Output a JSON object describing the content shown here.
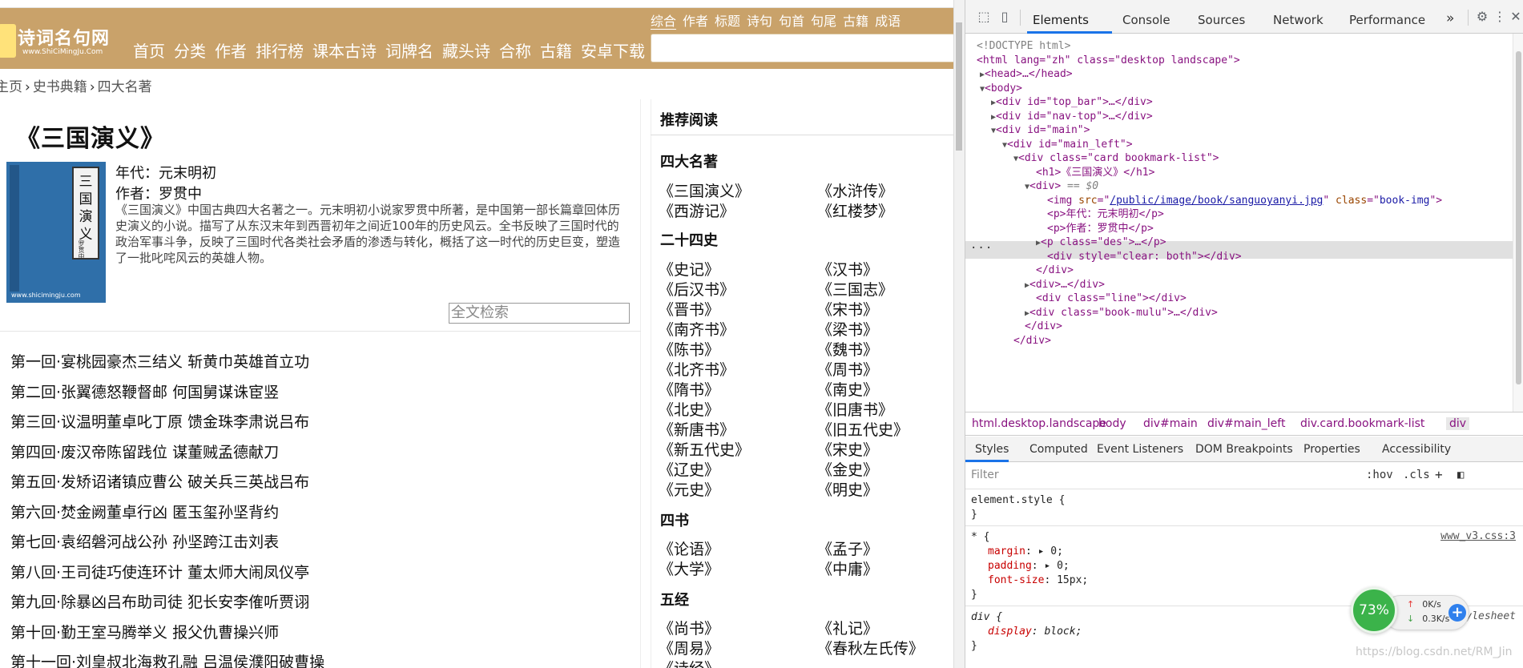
{
  "site": {
    "logo_title": "诗词名句网",
    "logo_sub": "www.ShiCiMingJu.Com",
    "nav": [
      "首页",
      "分类",
      "作者",
      "排行榜",
      "课本古诗",
      "词牌名",
      "藏头诗",
      "合称",
      "古籍",
      "安卓下载"
    ],
    "search_tabs": [
      "综合",
      "作者",
      "标题",
      "诗句",
      "句首",
      "句尾",
      "古籍",
      "成语"
    ],
    "breadcrumb": [
      "主页",
      "史书典籍",
      "四大名著"
    ]
  },
  "book": {
    "title": "《三国演义》",
    "cover_label": "三国演义",
    "cover_author": "罗贯中",
    "cover_url": "www.shicimingju.com",
    "era": "年代：元末明初",
    "author": "作者：罗贯中",
    "description": "《三国演义》中国古典四大名著之一。元末明初小说家罗贯中所著，是中国第一部长篇章回体历史演义的小说。描写了从东汉末年到西晋初年之间近100年的历史风云。全书反映了三国时代的政治军事斗争，反映了三国时代各类社会矛盾的渗透与转化，概括了这一时代的历史巨变，塑造了一批叱咤风云的英雄人物。",
    "fulltext_placeholder": "全文检索",
    "chapters": [
      "第一回·宴桃园豪杰三结义 斩黄巾英雄首立功",
      "第二回·张翼德怒鞭督邮 何国舅谋诛宦竖",
      "第三回·议温明董卓叱丁原 馈金珠李肃说吕布",
      "第四回·废汉帝陈留践位 谋董贼孟德献刀",
      "第五回·发矫诏诸镇应曹公 破关兵三英战吕布",
      "第六回·焚金阙董卓行凶 匿玉玺孙坚背约",
      "第七回·袁绍磐河战公孙 孙坚跨江击刘表",
      "第八回·王司徒巧使连环计 董太师大闹凤仪亭",
      "第九回·除暴凶吕布助司徒 犯长安李傕听贾诩",
      "第十回·勤王室马腾举义 报父仇曹操兴师",
      "第十一回·刘皇叔北海救孔融 吕温侯濮阳破曹操"
    ]
  },
  "sidebar": {
    "heading": "推荐阅读",
    "groups": [
      {
        "title": "四大名著",
        "books": [
          "《三国演义》",
          "《水浒传》",
          "《西游记》",
          "《红楼梦》"
        ]
      },
      {
        "title": "二十四史",
        "books": [
          "《史记》",
          "《汉书》",
          "《后汉书》",
          "《三国志》",
          "《晋书》",
          "《宋书》",
          "《南齐书》",
          "《梁书》",
          "《陈书》",
          "《魏书》",
          "《北齐书》",
          "《周书》",
          "《隋书》",
          "《南史》",
          "《北史》",
          "《旧唐书》",
          "《新唐书》",
          "《旧五代史》",
          "《新五代史》",
          "《宋史》",
          "《辽史》",
          "《金史》",
          "《元史》",
          "《明史》"
        ]
      },
      {
        "title": "四书",
        "books": [
          "《论语》",
          "《孟子》",
          "《大学》",
          "《中庸》"
        ]
      },
      {
        "title": "五经",
        "books": [
          "《尚书》",
          "《礼记》",
          "《周易》",
          "《春秋左氏传》",
          "《诗经》"
        ]
      }
    ]
  },
  "devtools": {
    "tabs": [
      "Elements",
      "Console",
      "Sources",
      "Network",
      "Performance"
    ],
    "more_tabs": "»",
    "breadcrumbs": [
      "html.desktop.landscape",
      "body",
      "div#main",
      "div#main_left",
      "div.card.bookmark-list",
      "div"
    ],
    "pane_tabs": [
      "Styles",
      "Computed",
      "Event Listeners",
      "DOM Breakpoints",
      "Properties",
      "Accessibility"
    ],
    "filter_placeholder": "Filter",
    "hov": ":hov",
    "cls": ".cls",
    "dom": {
      "doctype": "<!DOCTYPE html>",
      "html_open": "<html lang=\"zh\" class=\"desktop landscape\">",
      "head": "<head>…</head>",
      "body": "<body>",
      "top_bar": "<div id=\"top_bar\">…</div>",
      "nav_top": "<div id=\"nav-top\">…</div>",
      "main": "<div id=\"main\">",
      "main_left": "<div id=\"main_left\">",
      "card": "<div class=\"card bookmark-list\">",
      "h1": "<h1>《三国演义》</h1>",
      "div_sel": "<div>",
      "sel_marker": "== $0",
      "img_src": "/public/image/book/sanguoyanyi.jpg",
      "p_era": "<p>年代：元末明初</p>",
      "p_author": "<p>作者：罗贯中</p>",
      "p_des": "<p class=\"des\">…</p>",
      "clear": "<div style=\"clear: both\"></div>",
      "div_close": "</div>",
      "div_collapsed": "<div>…</div>",
      "line": "<div class=\"line\"></div>",
      "mulu": "<div class=\"book-mulu\">…</div>",
      "div_close2": "</div>",
      "div_close3": "</div>"
    },
    "styles": {
      "element_style": "element.style {",
      "close": "}",
      "star_selector": "* {",
      "star_source": "www_v3.css:3",
      "margin": "0;",
      "padding": "0;",
      "font_size": "15px;",
      "div_selector": "div {",
      "div_source": "user agent stylesheet",
      "display": "block;"
    }
  },
  "widget": {
    "percent": "73%",
    "up": "0K/s",
    "down": "0.3K/s"
  },
  "watermark": "https://blog.csdn.net/RM_Jin"
}
